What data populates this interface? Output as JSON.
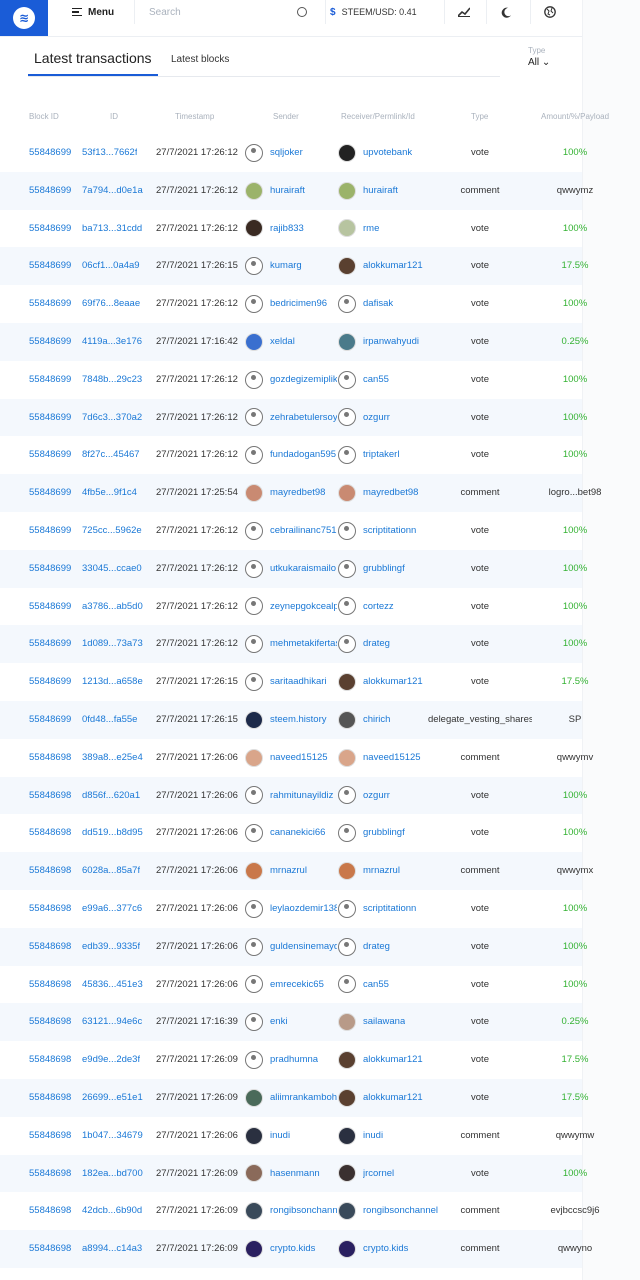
{
  "header": {
    "menu_label": "Menu",
    "search_placeholder": "Search",
    "price_label": "STEEM/USD: 0.41",
    "icons": [
      "logo-icon",
      "menu-icon",
      "search-icon",
      "dollar-icon",
      "chart-icon",
      "moon-icon",
      "globe-icon"
    ]
  },
  "tabs": [
    {
      "label": "Latest transactions",
      "active": true
    },
    {
      "label": "Latest blocks",
      "active": false
    }
  ],
  "filter": {
    "label": "Type",
    "value": "All"
  },
  "columns": [
    "Block ID",
    "ID",
    "Timestamp",
    "Sender",
    "Receiver/Permlink/Id",
    "Type",
    "Amount/%/Payload"
  ],
  "rows": [
    {
      "block": "55848699",
      "id": "53f13...7662f",
      "ts": "27/7/2021 17:26:12",
      "sender": "sqljoker",
      "s_av": "default",
      "receiver": "upvotebank",
      "r_av": "#222222",
      "type": "vote",
      "amount": "100%",
      "green": true
    },
    {
      "block": "55848699",
      "id": "7a794...d0e1a",
      "ts": "27/7/2021 17:26:12",
      "sender": "hurairaft",
      "s_av": "#9bb36a",
      "receiver": "hurairaft",
      "r_av": "#9bb36a",
      "type": "comment",
      "amount": "qwwymz",
      "green": false
    },
    {
      "block": "55848699",
      "id": "ba713...31cdd",
      "ts": "27/7/2021 17:26:12",
      "sender": "rajib833",
      "s_av": "#3a2a22",
      "receiver": "rme",
      "r_av": "#b7c4a0",
      "type": "vote",
      "amount": "100%",
      "green": true
    },
    {
      "block": "55848699",
      "id": "06cf1...0a4a9",
      "ts": "27/7/2021 17:26:15",
      "sender": "kumarg",
      "s_av": "default",
      "receiver": "alokkumar121",
      "r_av": "#5a4030",
      "type": "vote",
      "amount": "17.5%",
      "green": true
    },
    {
      "block": "55848699",
      "id": "69f76...8eaae",
      "ts": "27/7/2021 17:26:12",
      "sender": "bedricimen96",
      "s_av": "default",
      "receiver": "dafisak",
      "r_av": "default",
      "type": "vote",
      "amount": "100%",
      "green": true
    },
    {
      "block": "55848699",
      "id": "4119a...3e176",
      "ts": "27/7/2021 17:16:42",
      "sender": "xeldal",
      "s_av": "#3a6fcf",
      "receiver": "irpanwahyudi",
      "r_av": "#4a7a8a",
      "type": "vote",
      "amount": "0.25%",
      "green": true
    },
    {
      "block": "55848699",
      "id": "7848b...29c23",
      "ts": "27/7/2021 17:26:12",
      "sender": "gozdegizemiplik",
      "s_av": "default",
      "receiver": "can55",
      "r_av": "default",
      "type": "vote",
      "amount": "100%",
      "green": true
    },
    {
      "block": "55848699",
      "id": "7d6c3...370a2",
      "ts": "27/7/2021 17:26:12",
      "sender": "zehrabetulersoy",
      "s_av": "default",
      "receiver": "ozgurr",
      "r_av": "default",
      "type": "vote",
      "amount": "100%",
      "green": true
    },
    {
      "block": "55848699",
      "id": "8f27c...45467",
      "ts": "27/7/2021 17:26:12",
      "sender": "fundadogan595",
      "s_av": "default",
      "receiver": "triptakerl",
      "r_av": "default",
      "type": "vote",
      "amount": "100%",
      "green": true
    },
    {
      "block": "55848699",
      "id": "4fb5e...9f1c4",
      "ts": "27/7/2021 17:25:54",
      "sender": "mayredbet98",
      "s_av": "#c98a72",
      "receiver": "mayredbet98",
      "r_av": "#c98a72",
      "type": "comment",
      "amount": "logro...bet98",
      "green": false
    },
    {
      "block": "55848699",
      "id": "725cc...5962e",
      "ts": "27/7/2021 17:26:12",
      "sender": "cebrailinanc751",
      "s_av": "default",
      "receiver": "scriptitationn",
      "r_av": "default",
      "type": "vote",
      "amount": "100%",
      "green": true
    },
    {
      "block": "55848699",
      "id": "33045...ccae0",
      "ts": "27/7/2021 17:26:12",
      "sender": "utkukaraismailo",
      "s_av": "default",
      "receiver": "grubblingf",
      "r_av": "default",
      "type": "vote",
      "amount": "100%",
      "green": true
    },
    {
      "block": "55848699",
      "id": "a3786...ab5d0",
      "ts": "27/7/2021 17:26:12",
      "sender": "zeynepgokcealp",
      "s_av": "default",
      "receiver": "cortezz",
      "r_av": "default",
      "type": "vote",
      "amount": "100%",
      "green": true
    },
    {
      "block": "55848699",
      "id": "1d089...73a73",
      "ts": "27/7/2021 17:26:12",
      "sender": "mehmetakifertas",
      "s_av": "default",
      "receiver": "drateg",
      "r_av": "default",
      "type": "vote",
      "amount": "100%",
      "green": true
    },
    {
      "block": "55848699",
      "id": "1213d...a658e",
      "ts": "27/7/2021 17:26:15",
      "sender": "saritaadhikari",
      "s_av": "default",
      "receiver": "alokkumar121",
      "r_av": "#5a4030",
      "type": "vote",
      "amount": "17.5%",
      "green": true
    },
    {
      "block": "55848699",
      "id": "0fd48...fa55e",
      "ts": "27/7/2021 17:26:15",
      "sender": "steem.history",
      "s_av": "#1d2a4a",
      "receiver": "chirich",
      "r_av": "#555555",
      "type": "delegate_vesting_shares",
      "amount": "SP",
      "green": false
    },
    {
      "block": "55848698",
      "id": "389a8...e25e4",
      "ts": "27/7/2021 17:26:06",
      "sender": "naveed15125",
      "s_av": "#d9a58a",
      "receiver": "naveed15125",
      "r_av": "#d9a58a",
      "type": "comment",
      "amount": "qwwymv",
      "green": false
    },
    {
      "block": "55848698",
      "id": "d856f...620a1",
      "ts": "27/7/2021 17:26:06",
      "sender": "rahmitunayildiz",
      "s_av": "default",
      "receiver": "ozgurr",
      "r_av": "default",
      "type": "vote",
      "amount": "100%",
      "green": true
    },
    {
      "block": "55848698",
      "id": "dd519...b8d95",
      "ts": "27/7/2021 17:26:06",
      "sender": "cananekici66",
      "s_av": "default",
      "receiver": "grubblingf",
      "r_av": "default",
      "type": "vote",
      "amount": "100%",
      "green": true
    },
    {
      "block": "55848698",
      "id": "6028a...85a7f",
      "ts": "27/7/2021 17:26:06",
      "sender": "mrnazrul",
      "s_av": "#c9784a",
      "receiver": "mrnazrul",
      "r_av": "#c9784a",
      "type": "comment",
      "amount": "qwwymx",
      "green": false
    },
    {
      "block": "55848698",
      "id": "e99a6...377c6",
      "ts": "27/7/2021 17:26:06",
      "sender": "leylaozdemir138",
      "s_av": "default",
      "receiver": "scriptitationn",
      "r_av": "default",
      "type": "vote",
      "amount": "100%",
      "green": true
    },
    {
      "block": "55848698",
      "id": "edb39...9335f",
      "ts": "27/7/2021 17:26:06",
      "sender": "guldensinemayd",
      "s_av": "default",
      "receiver": "drateg",
      "r_av": "default",
      "type": "vote",
      "amount": "100%",
      "green": true
    },
    {
      "block": "55848698",
      "id": "45836...451e3",
      "ts": "27/7/2021 17:26:06",
      "sender": "emrecekic65",
      "s_av": "default",
      "receiver": "can55",
      "r_av": "default",
      "type": "vote",
      "amount": "100%",
      "green": true
    },
    {
      "block": "55848698",
      "id": "63121...94e6c",
      "ts": "27/7/2021 17:16:39",
      "sender": "enki",
      "s_av": "default",
      "receiver": "sailawana",
      "r_av": "#b89a88",
      "type": "vote",
      "amount": "0.25%",
      "green": true
    },
    {
      "block": "55848698",
      "id": "e9d9e...2de3f",
      "ts": "27/7/2021 17:26:09",
      "sender": "pradhumna",
      "s_av": "default",
      "receiver": "alokkumar121",
      "r_av": "#5a4030",
      "type": "vote",
      "amount": "17.5%",
      "green": true
    },
    {
      "block": "55848698",
      "id": "26699...e51e1",
      "ts": "27/7/2021 17:26:09",
      "sender": "aliimrankamboh",
      "s_av": "#4a6a5a",
      "receiver": "alokkumar121",
      "r_av": "#5a4030",
      "type": "vote",
      "amount": "17.5%",
      "green": true
    },
    {
      "block": "55848698",
      "id": "1b047...34679",
      "ts": "27/7/2021 17:26:06",
      "sender": "inudi",
      "s_av": "#2a3040",
      "receiver": "inudi",
      "r_av": "#2a3040",
      "type": "comment",
      "amount": "qwwymw",
      "green": false
    },
    {
      "block": "55848698",
      "id": "182ea...bd700",
      "ts": "27/7/2021 17:26:09",
      "sender": "hasenmann",
      "s_av": "#8a6a5a",
      "receiver": "jrcornel",
      "r_av": "#3a3030",
      "type": "vote",
      "amount": "100%",
      "green": true
    },
    {
      "block": "55848698",
      "id": "42dcb...6b90d",
      "ts": "27/7/2021 17:26:09",
      "sender": "rongibsonchannel",
      "s_av": "#3a4a5a",
      "receiver": "rongibsonchannel",
      "r_av": "#3a4a5a",
      "type": "comment",
      "amount": "evjbccsc9j6",
      "green": false
    },
    {
      "block": "55848698",
      "id": "a8994...c14a3",
      "ts": "27/7/2021 17:26:09",
      "sender": "crypto.kids",
      "s_av": "#2a2060",
      "receiver": "crypto.kids",
      "r_av": "#2a2060",
      "type": "comment",
      "amount": "qwwyno",
      "green": false
    }
  ]
}
